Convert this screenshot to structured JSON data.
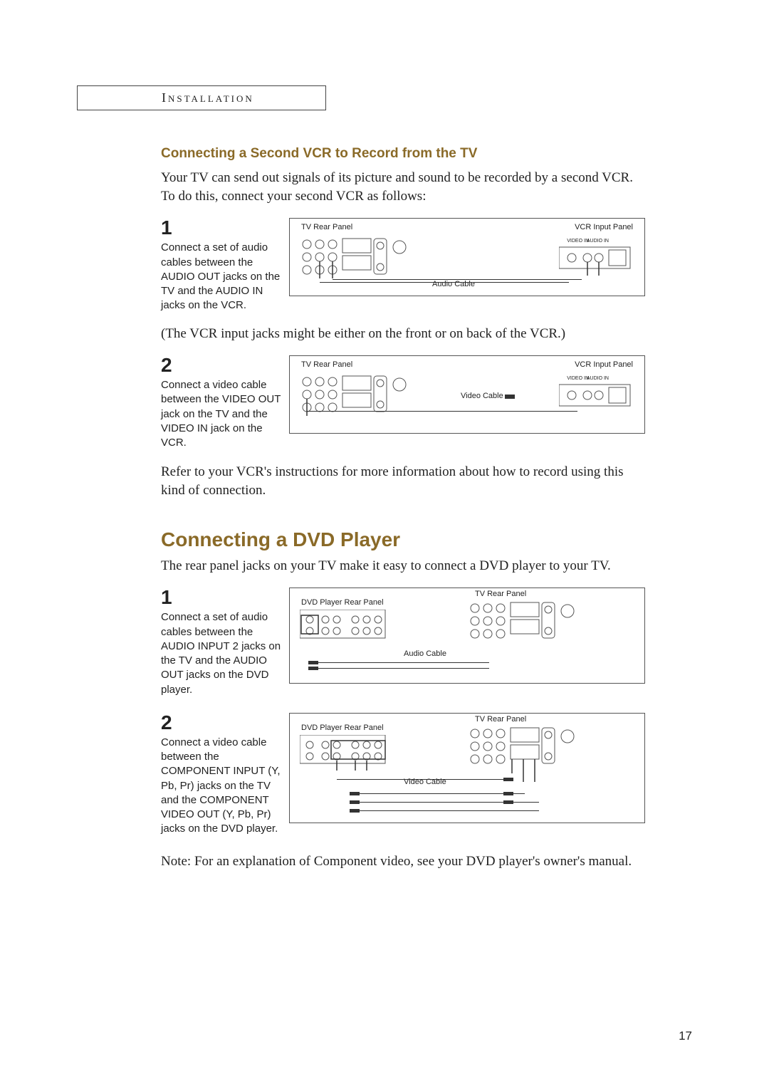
{
  "section_header": "Installation",
  "vcr_section": {
    "title": "Connecting a Second VCR to Record from the TV",
    "intro": "Your TV can send out signals of its picture and sound to be recorded by a second VCR. To do this, connect your second VCR as follows:",
    "step1": {
      "num": "1",
      "text": "Connect a set of audio cables between the AUDIO OUT jacks on the TV and the AUDIO IN jacks on the VCR.",
      "tv_label": "TV Rear Panel",
      "vcr_label": "VCR Input Panel",
      "cable_label": "Audio Cable",
      "video_in": "VIDEO IN",
      "audio_in": "AUDIO IN"
    },
    "mid_note": "(The VCR input jacks might be either on the front or on back of the VCR.)",
    "step2": {
      "num": "2",
      "text": "Connect a video cable between the VIDEO OUT jack on the TV and the VIDEO IN jack on the VCR.",
      "tv_label": "TV Rear Panel",
      "vcr_label": "VCR Input Panel",
      "cable_label": "Video Cable",
      "video_in": "VIDEO IN",
      "audio_in": "AUDIO IN"
    },
    "outro": "Refer to your VCR's instructions for more information about how to record using this kind of connection."
  },
  "dvd_section": {
    "title": "Connecting a DVD Player",
    "intro": "The rear panel jacks on your TV make it easy to connect a DVD player to your TV.",
    "step1": {
      "num": "1",
      "text": "Connect a set of audio cables between the AUDIO INPUT 2 jacks on the TV and the AUDIO OUT jacks on the DVD player.",
      "dvd_label": "DVD Player Rear Panel",
      "tv_label": "TV Rear Panel",
      "cable_label": "Audio Cable"
    },
    "step2": {
      "num": "2",
      "text": "Connect a video cable between the COMPONENT INPUT (Y, Pb, Pr) jacks on the TV and the COMPONENT VIDEO OUT (Y, Pb, Pr) jacks on the DVD player.",
      "dvd_label": "DVD Player Rear Panel",
      "tv_label": "TV Rear Panel",
      "cable_label": "Video Cable"
    },
    "note": "Note: For an explanation of Component video, see your DVD player's owner's manual."
  },
  "page_number": "17"
}
